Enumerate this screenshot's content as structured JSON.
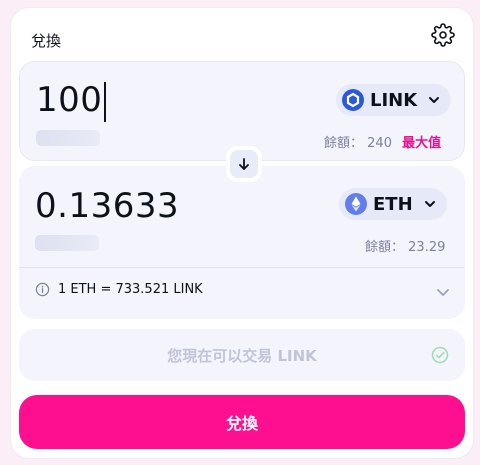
{
  "header": {
    "title": "兌換"
  },
  "input_panel": {
    "amount": "100",
    "token": {
      "symbol": "LINK",
      "icon": "chainlink-icon",
      "color": "#2a5ada"
    },
    "balance_label": "餘額：",
    "balance_value": "240",
    "max_label": "最大值"
  },
  "output_panel": {
    "amount": "0.13633",
    "token": {
      "symbol": "ETH",
      "icon": "ethereum-icon",
      "color": "#627eea"
    },
    "balance_label": "餘額：",
    "balance_value": "23.29"
  },
  "rate": {
    "text": "1 ETH = 733.521 LINK"
  },
  "status": {
    "text": "您現在可以交易 LINK"
  },
  "swap_button": {
    "label": "兌換"
  },
  "colors": {
    "accent": "#fd0f8f",
    "panel": "#f4f5fc",
    "status_check": "#9fdcb4"
  }
}
